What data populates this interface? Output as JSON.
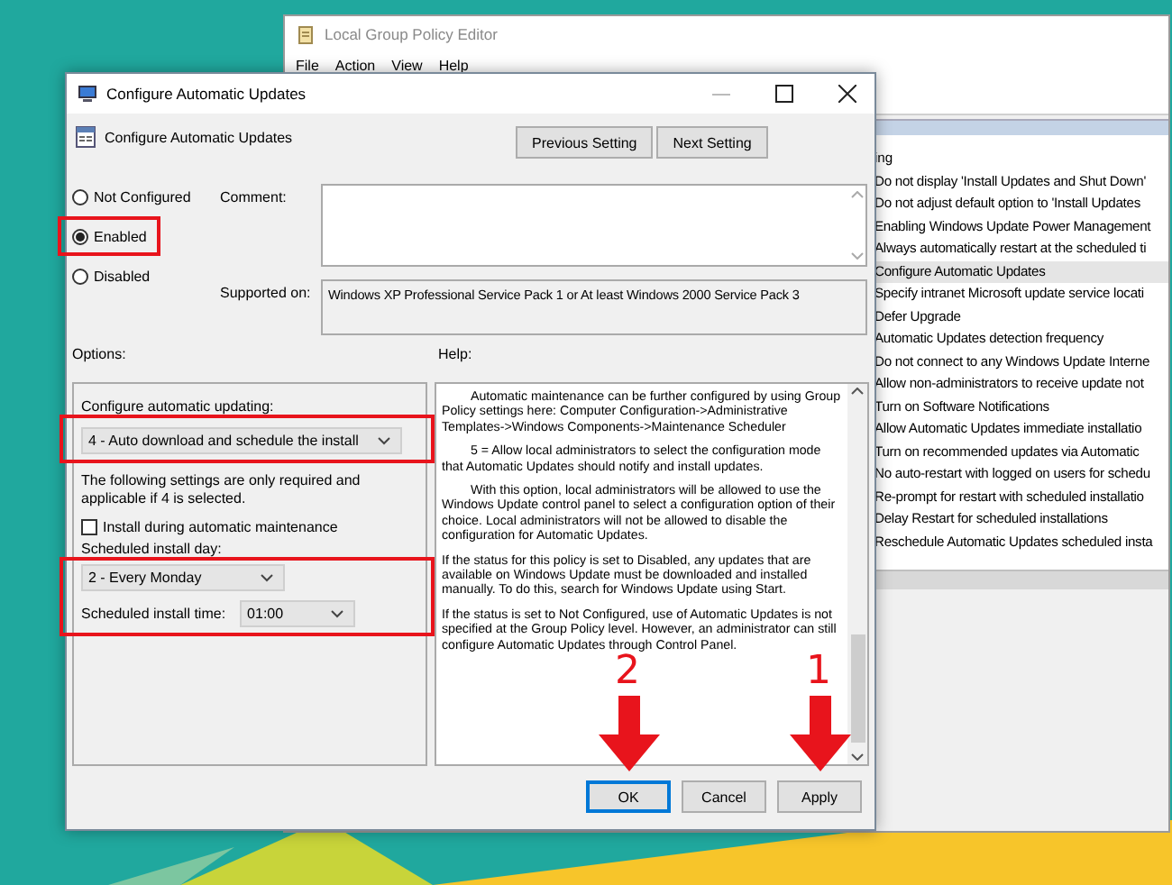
{
  "editor_window": {
    "title": "Local Group Policy Editor",
    "menu": [
      "File",
      "Action",
      "View",
      "Help"
    ],
    "column_fragment": "ing",
    "policies": [
      {
        "label": "Do not display 'Install Updates and Shut Down'",
        "selected": false
      },
      {
        "label": "Do not adjust default option to 'Install Updates",
        "selected": false
      },
      {
        "label": "Enabling Windows Update Power Management",
        "selected": false
      },
      {
        "label": "Always automatically restart at the scheduled ti",
        "selected": false
      },
      {
        "label": "Configure Automatic Updates",
        "selected": true
      },
      {
        "label": "Specify intranet Microsoft update service locati",
        "selected": false
      },
      {
        "label": "Defer Upgrade",
        "selected": false
      },
      {
        "label": "Automatic Updates detection frequency",
        "selected": false
      },
      {
        "label": "Do not connect to any Windows Update Interne",
        "selected": false
      },
      {
        "label": "Allow non-administrators to receive update not",
        "selected": false
      },
      {
        "label": "Turn on Software Notifications",
        "selected": false
      },
      {
        "label": "Allow Automatic Updates immediate installatio",
        "selected": false
      },
      {
        "label": "Turn on recommended updates via Automatic",
        "selected": false
      },
      {
        "label": "No auto-restart with logged on users for schedu",
        "selected": false
      },
      {
        "label": "Re-prompt for restart with scheduled installatio",
        "selected": false
      },
      {
        "label": "Delay Restart for scheduled installations",
        "selected": false
      },
      {
        "label": "Reschedule Automatic Updates scheduled insta",
        "selected": false
      }
    ]
  },
  "dialog": {
    "title": "Configure Automatic Updates",
    "heading": "Configure Automatic Updates",
    "nav_buttons": [
      "Previous Setting",
      "Next Setting"
    ],
    "states": [
      {
        "kind": "radio",
        "label": "Not Configured",
        "selected": false
      },
      {
        "kind": "frame",
        "items": [
          {
            "kind": "radio",
            "label": "Enabled",
            "selected": true
          }
        ]
      },
      {
        "kind": "radio",
        "label": "Disabled",
        "selected": false
      }
    ],
    "comment_label": "Comment:",
    "supported_label": "Supported on:",
    "supported_value": "Windows XP Professional Service Pack 1 or At least Windows 2000 Service Pack 3",
    "options_label": "Options:",
    "help_label": "Help:",
    "options": [
      {
        "kind": "label",
        "text": "Configure automatic updating:"
      },
      {
        "kind": "frame",
        "items": [
          {
            "kind": "dropdown",
            "value": "4 - Auto download and schedule the install"
          }
        ]
      },
      {
        "kind": "note",
        "text": "The following settings are only required and applicable if 4 is selected."
      },
      {
        "kind": "checkbox",
        "text": "Install during automatic maintenance",
        "checked": false
      },
      {
        "kind": "label",
        "text": "Scheduled install day:"
      },
      {
        "kind": "frame",
        "items": [
          {
            "kind": "dropdown",
            "value": "2 - Every Monday"
          },
          {
            "kind": "time",
            "text": "Scheduled install time:",
            "value": "01:00"
          }
        ]
      }
    ],
    "help": [
      {
        "text": "Automatic maintenance can be further configured by using Group Policy settings here: Computer Configuration->Administrative Templates->Windows Components->Maintenance Scheduler",
        "indented": true
      },
      {
        "text": "5 = Allow local administrators to select the configuration mode that Automatic Updates should notify and install updates.",
        "indented": true
      },
      {
        "text": "With this option, local administrators will be allowed to use the Windows Update control panel to select a configuration option of their choice. Local administrators will not be allowed to disable the configuration for Automatic Updates.",
        "indented": true
      },
      {
        "text": "If the status for this policy is set to Disabled, any updates that are available on Windows Update must be downloaded and installed manually. To do this, search for Windows Update using Start.",
        "indented": false
      },
      {
        "text": "If the status is set to Not Configured, use of Automatic Updates is not specified at the Group Policy level. However, an administrator can still configure Automatic Updates through Control Panel.",
        "indented": false
      }
    ],
    "buttons": [
      {
        "label": "OK",
        "focused": true
      },
      {
        "label": "Cancel",
        "focused": false
      },
      {
        "label": "Apply",
        "focused": false
      }
    ]
  },
  "annotations": [
    {
      "number": "2"
    },
    {
      "number": "1"
    }
  ]
}
